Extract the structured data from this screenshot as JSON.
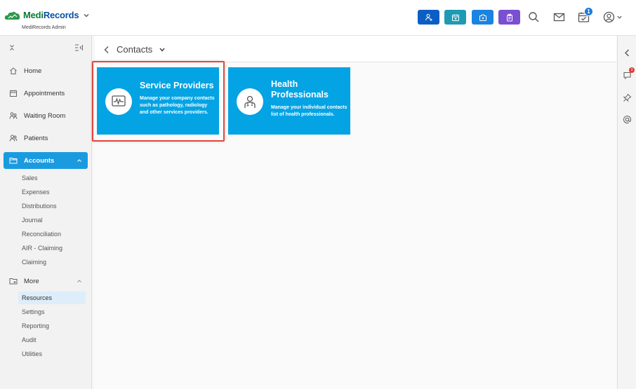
{
  "header": {
    "brand": "MediRecords",
    "org_label": "MediRecords Admin",
    "notification_count": "1",
    "colors": {
      "add_patient": "#0b5fc4",
      "calendar": "#1e9ab5",
      "medical": "#1a84e0",
      "clipboard": "#7a4fd1"
    },
    "icons": [
      "add-patient-icon",
      "calendar-plus-icon",
      "medical-kit-icon",
      "clipboard-icon",
      "search-icon",
      "mail-icon",
      "calendar-check-icon",
      "user-account-icon"
    ]
  },
  "sidebar": {
    "nav": [
      {
        "label": "Home",
        "icon": "home-icon"
      },
      {
        "label": "Appointments",
        "icon": "calendar-icon"
      },
      {
        "label": "Waiting Room",
        "icon": "waiting-room-icon"
      },
      {
        "label": "Patients",
        "icon": "patients-icon"
      },
      {
        "label": "Accounts",
        "icon": "folder-icon"
      }
    ],
    "accounts_sub": [
      "Sales",
      "Expenses",
      "Distributions",
      "Journal",
      "Reconciliation",
      "AIR - Claiming",
      "Claiming"
    ],
    "more": {
      "label": "More",
      "icon": "folder-plus-icon"
    },
    "more_sub": [
      "Resources",
      "Settings",
      "Reporting",
      "Audit",
      "Utilities"
    ],
    "accent_color": "#1a9be0"
  },
  "main": {
    "breadcrumb_title": "Contacts",
    "cards": [
      {
        "title": "Service Providers",
        "description": "Manage your company contacts such as pathology, radiology and other services providers.",
        "icon": "monitor-pulse-icon"
      },
      {
        "title_line1": "Health",
        "title_line2": "Professionals",
        "description": "Manage your individual contacts list of health professionals.",
        "icon": "doctor-icon"
      }
    ],
    "card_color": "#03a3e4"
  },
  "rail": {
    "badge": "3",
    "icons": [
      "collapse-left-icon",
      "chat-icon",
      "pin-icon",
      "at-icon"
    ]
  }
}
